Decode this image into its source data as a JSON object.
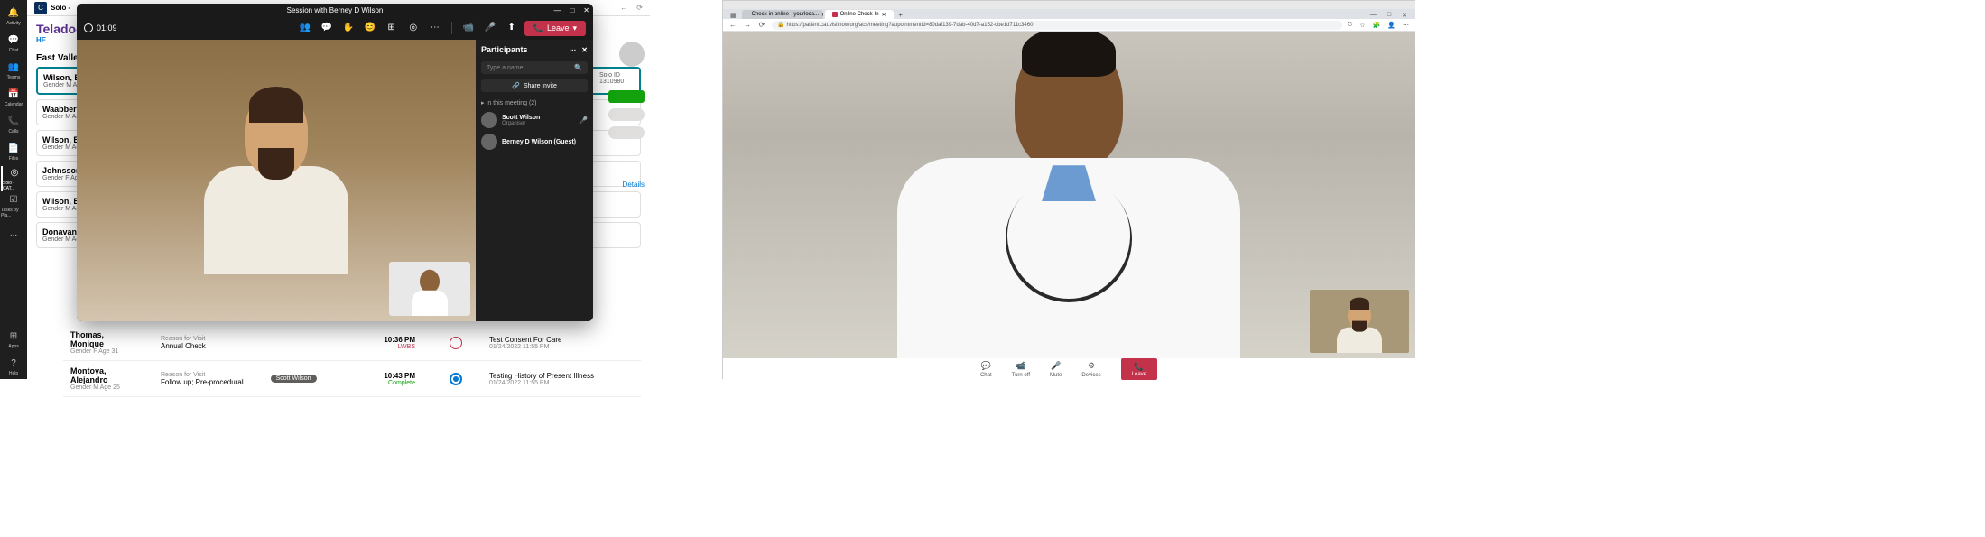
{
  "teams_rail": {
    "items": [
      {
        "label": "Activity"
      },
      {
        "label": "Chat"
      },
      {
        "label": "Teams"
      },
      {
        "label": "Calendar"
      },
      {
        "label": "Calls"
      },
      {
        "label": "Files"
      },
      {
        "label": "Solo - CAT..."
      },
      {
        "label": "Tasks by Pla..."
      }
    ],
    "more": "...",
    "apps": "Apps",
    "help": "Help"
  },
  "solo": {
    "app_name": "Solo -",
    "brand": "Teladoc",
    "brand_sub": "HE",
    "location": "East Valley",
    "solo_id_label": "Solo ID",
    "solo_id": "1310980",
    "details": "Details",
    "patients": [
      {
        "name": "Wilson, Be...",
        "meta": "Gender M  Ag..."
      },
      {
        "name": "Waabberi, ...",
        "meta": "Gender M  Ag..."
      },
      {
        "name": "Wilson, Be...",
        "meta": "Gender M  Ag..."
      },
      {
        "name": "Johnsson, ...",
        "meta": "Gender F  Age..."
      },
      {
        "name": "Wilson, Be...",
        "meta": "Gender M  Ag..."
      },
      {
        "name": "Donavan, ...",
        "meta": "Gender M  Ag..."
      }
    ],
    "bottom": [
      {
        "name": "Thomas, Monique",
        "meta": "Gender F  Age 31",
        "reason_label": "Reason for Visit",
        "reason": "Annual Check",
        "time": "10:36 PM",
        "status": "LWBS",
        "col2_title": "Test Consent For Care",
        "col2_date": "01/24/2022 11:55 PM"
      },
      {
        "name": "Montoya, Alejandro",
        "meta": "Gender M  Age 25",
        "reason_label": "Reason for Visit",
        "reason": "Follow up; Pre-procedural",
        "assignee": "Scott Wilson",
        "time": "10:43 PM",
        "status": "Complete",
        "col2_title": "Testing History of Present Illness",
        "col2_date": "01/24/2022 11:55 PM"
      }
    ]
  },
  "call": {
    "title": "Session with Berney D Wilson",
    "timer": "01:09",
    "leave": "Leave",
    "participants_title": "Participants",
    "search_placeholder": "Type a name",
    "share_invite": "Share invite",
    "meeting_header": "In this meeting (2)",
    "participants": [
      {
        "name": "Scott Wilson",
        "role": "Organiser"
      },
      {
        "name": "Berney D Wilson (Guest)",
        "role": ""
      }
    ]
  },
  "browser": {
    "tabs": [
      {
        "title": "Check-in online - yourloca...",
        "favicon": "#4285f4"
      },
      {
        "title": "Online Check-In",
        "favicon": "#c4314b"
      }
    ],
    "url": "https://patient.cat.visitnow.org/acs/meeting?appointmentId=80daf139-7dab-40d7-a152-cbe1d711c3460",
    "controls": [
      {
        "label": "Chat"
      },
      {
        "label": "Turn off"
      },
      {
        "label": "Mute"
      },
      {
        "label": "Devices"
      },
      {
        "label": "Leave"
      }
    ]
  }
}
